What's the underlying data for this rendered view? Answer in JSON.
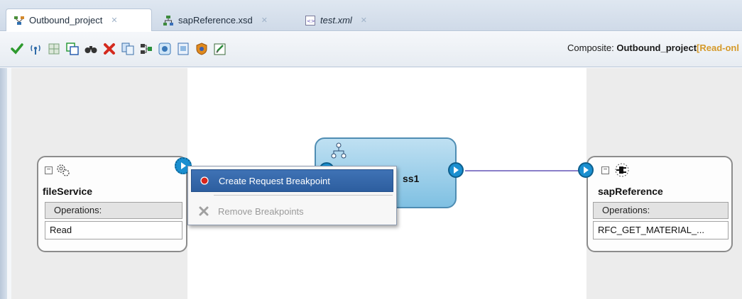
{
  "tabs": [
    {
      "label": "Outbound_project",
      "active": true,
      "italic": false,
      "icon": "composite-icon"
    },
    {
      "label": "sapReference.xsd",
      "active": false,
      "italic": false,
      "icon": "schema-icon"
    },
    {
      "label": "test.xml",
      "active": false,
      "italic": true,
      "icon": "xml-icon"
    }
  ],
  "toolbar": {
    "buttons": [
      "validate-check-icon",
      "wireless-icon",
      "grid-icon",
      "layers-icon",
      "binoculars-icon",
      "delete-x-icon",
      "copy-icon",
      "flow-icon",
      "component-icon",
      "document-icon",
      "shield-icon",
      "edit-icon"
    ],
    "composite_prefix": "Composite: ",
    "composite_name": "Outbound_project",
    "composite_status": "[Read-onl"
  },
  "canvas": {
    "left_service": {
      "name": "fileService",
      "operations_header": "Operations:",
      "operation": "Read",
      "icon": "gears-icon"
    },
    "process": {
      "name_fragment": "ss1",
      "icon": "process-hierarchy-icon"
    },
    "right_reference": {
      "name": "sapReference",
      "operations_header": "Operations:",
      "operation": "RFC_GET_MATERIAL_...",
      "icon": "plug-adapter-icon"
    }
  },
  "context_menu": {
    "items": [
      {
        "label": "Create Request Breakpoint",
        "icon": "red-dot-icon",
        "highlighted": true,
        "enabled": true
      },
      {
        "label": "Remove Breakpoints",
        "icon": "grey-x-icon",
        "highlighted": false,
        "enabled": false
      }
    ]
  },
  "colors": {
    "accent_blue": "#1a8fd0",
    "menu_highlight": "#2d5e9f",
    "process_fill": "#7fc0e2",
    "readonly_orange": "#d59a2a"
  }
}
